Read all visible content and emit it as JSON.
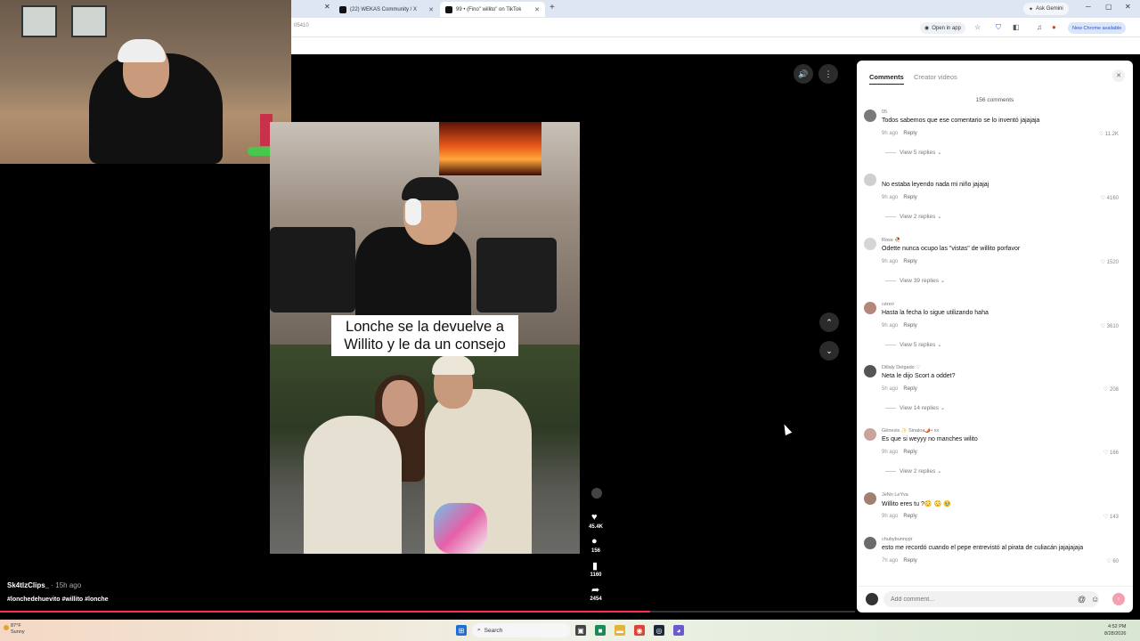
{
  "browser": {
    "tabs": [
      {
        "label": "(22) WEKAS Community / X",
        "active": false
      },
      {
        "label": "99 • (Fino\" willito\" on TikTok",
        "active": true
      }
    ],
    "new_tab": "+",
    "ask_gemini": "Ask Gemini",
    "url_fragment": "05410",
    "open_in_app": "Open in app",
    "new_chrome": "New Chrome available"
  },
  "video": {
    "caption": "Lonche se la devuelve a Willito y le da un consejo",
    "author": "Sk4tlzClips_",
    "posted": " · 15h ago",
    "hashtags": "#lonchedehuevito #willito #lonche",
    "likes": "45.4K",
    "comments": "156",
    "saves": "1160",
    "shares": "2454",
    "progress": 0.76
  },
  "comments_panel": {
    "tab_comments": "Comments",
    "tab_creator": "Creator videos",
    "count_label": "156 comments",
    "reply_label": "Reply",
    "add_placeholder": "Add comment...",
    "comments": [
      {
        "name": "05",
        "text": "Todos sabemos que ese comentario se lo inventó jajajaja",
        "ago": "9h ago",
        "likes": "11.2K",
        "replies": "View 5 replies",
        "avatar_color": "#7a7a7a"
      },
      {
        "name": "",
        "text": "No estaba leyendo nada mi niño jajajaj",
        "ago": "9h ago",
        "likes": "4160",
        "replies": "View 2 replies",
        "avatar_color": "#cfcfcf"
      },
      {
        "name": "Rose 🥀",
        "text": "Odette nunca ocupo las \"vistas\" de willito porfavor",
        "ago": "9h ago",
        "likes": "1520",
        "replies": "View 39 replies",
        "avatar_color": "#d6d6d6"
      },
      {
        "name": "céreri",
        "text": "Hasta la fecha lo sigue utilizando haha",
        "ago": "9h ago",
        "likes": "3610",
        "replies": "View 5 replies",
        "avatar_color": "#b5877a"
      },
      {
        "name": "Dillaly Delgado ♡",
        "text": "Neta le dijo Scort a oddet?",
        "ago": "5h ago",
        "likes": "208",
        "replies": "View 14 replies",
        "avatar_color": "#555555"
      },
      {
        "name": "Génesis ✨ Sinaloa🌶️• xx",
        "text": "Es que si weyyy no manches wilito",
        "ago": "9h ago",
        "likes": "166",
        "replies": "View 2 replies",
        "avatar_color": "#c9a49a"
      },
      {
        "name": "JeNn LeYva",
        "text": "Willito eres tu ?😳 😳 🥹",
        "ago": "9h ago",
        "likes": "143",
        "replies": "",
        "avatar_color": "#a08070"
      },
      {
        "name": "chubybunnypr",
        "text": "esto me recordó cuando el pepe entrevistó al pirata de culiacán jajajajaja",
        "ago": "7h ago",
        "likes": "60",
        "replies": "",
        "avatar_color": "#6b6b6b"
      }
    ]
  },
  "taskbar": {
    "weather_temp": "87°F",
    "weather_desc": "Sunny",
    "search_label": "Search",
    "time": "4:52 PM",
    "date": "8/28/2026"
  }
}
